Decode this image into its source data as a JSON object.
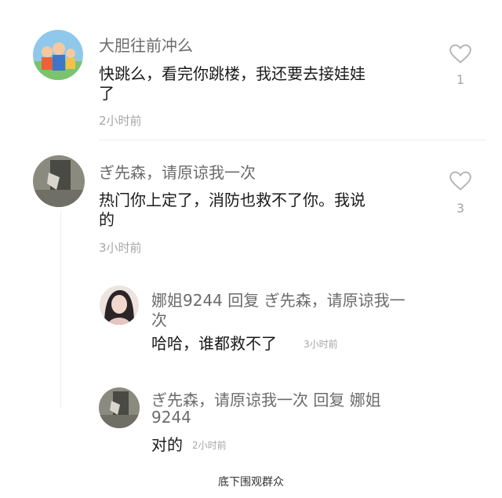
{
  "comments": [
    {
      "username": "大胆往前冲么",
      "text_line1": "快跳么，看完你跳楼，我还要去接娃娃",
      "text_line2": "了",
      "time": "2小时前",
      "likes": "1"
    },
    {
      "username": "ぎ先森，请原谅我一次",
      "text_line1": "热门你上定了，消防也救不了你。我说",
      "text_line2": "的",
      "time": "3小时前",
      "likes": "3",
      "replies": [
        {
          "header_line1": "娜姐9244  回复  ぎ先森，请原谅我一",
          "header_line2": "次",
          "text": "哈哈，谁都救不了",
          "time": "3小时前"
        },
        {
          "header_line1": "ぎ先森，请原谅我一次  回复  娜姐",
          "header_line2": "9244",
          "text": "对的",
          "time": "2小时前"
        }
      ]
    }
  ],
  "footer": "底下围观群众",
  "colors": {
    "background": "#ffffff",
    "username": "#6b6b6b",
    "text": "#1a1a1a",
    "muted": "#a6a6a6"
  },
  "icons": {
    "like": "heart-outline-icon"
  }
}
